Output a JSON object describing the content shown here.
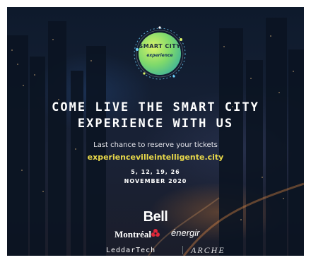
{
  "badge": {
    "title": "SMART CITY",
    "subtitle": "experience"
  },
  "headline": {
    "line1": "COME LIVE THE SMART CITY",
    "line2": "EXPERIENCE WITH US"
  },
  "tagline": "Last chance to reserve your tickets",
  "url": "experiencevilleintelligente.city",
  "event_dates": "5, 12, 19, 26",
  "event_month": "NOVEMBER 2020",
  "sponsors": {
    "bell": "Bell",
    "montreal": "Montréal",
    "energir": "énergir",
    "leddartech": "LeddarTech",
    "arche": "ARCHE"
  },
  "colors": {
    "url_accent": "#e8d84a",
    "badge_green": "#7fd96b",
    "badge_teal": "#1fa0b0",
    "montreal_red": "#e0283a"
  }
}
